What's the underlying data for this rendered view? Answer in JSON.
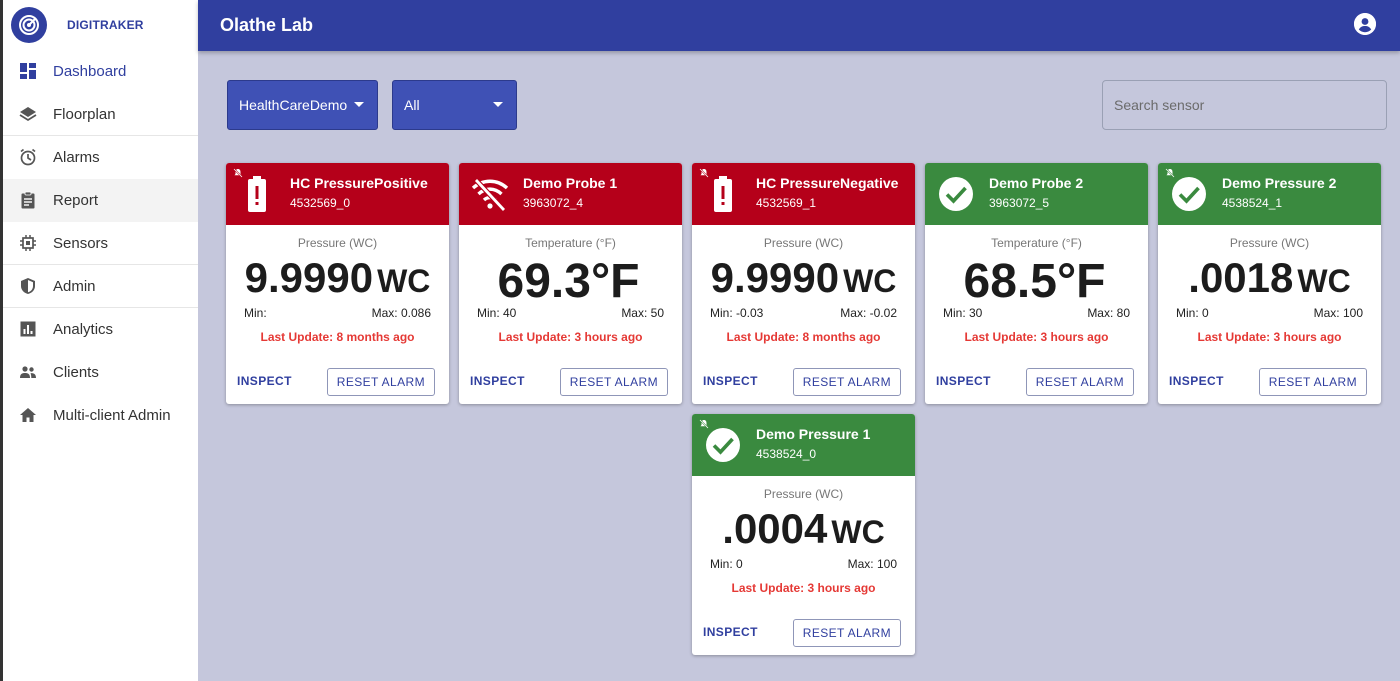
{
  "sidebar": {
    "brand": "DIGITRAKER",
    "items": [
      {
        "label": "Dashboard",
        "icon": "dashboard-icon"
      },
      {
        "label": "Floorplan",
        "icon": "layers-icon"
      },
      {
        "label": "Alarms",
        "icon": "alarm-clock-icon"
      },
      {
        "label": "Report",
        "icon": "clipboard-icon"
      },
      {
        "label": "Sensors",
        "icon": "chip-icon"
      },
      {
        "label": "Admin",
        "icon": "shield-icon"
      },
      {
        "label": "Analytics",
        "icon": "bar-chart-icon"
      },
      {
        "label": "Clients",
        "icon": "people-icon"
      },
      {
        "label": "Multi-client Admin",
        "icon": "home-icon"
      }
    ],
    "active": "Dashboard"
  },
  "header": {
    "title": "Olathe Lab"
  },
  "filters": {
    "group": "HealthCareDemo",
    "type": "All",
    "search_placeholder": "Search sensor"
  },
  "colors": {
    "primary": "#303f9f",
    "alarm": "#b5001a",
    "ok": "#3a8a3f",
    "update": "#e53935"
  },
  "cards": [
    {
      "name": "HC PressurePositive",
      "id": "4532569_0",
      "status": "alarm",
      "icon": "battery-alert-icon",
      "measure": "Pressure (WC)",
      "value": "9.9990",
      "unit": "WC",
      "min": "Min:",
      "max": "Max: 0.086",
      "update": "Last Update: 8 months ago",
      "inspect": "INSPECT",
      "reset": "RESET ALARM"
    },
    {
      "name": "Demo Probe 1",
      "id": "3963072_4",
      "status": "alarm",
      "icon": "wifi-off-icon",
      "measure": "Temperature (°F)",
      "value": "69.3°F",
      "unit": "",
      "min": "Min: 40",
      "max": "Max: 50",
      "update": "Last Update: 3 hours ago",
      "inspect": "INSPECT",
      "reset": "RESET ALARM"
    },
    {
      "name": "HC PressureNegative",
      "id": "4532569_1",
      "status": "alarm",
      "icon": "battery-alert-icon",
      "measure": "Pressure (WC)",
      "value": "9.9990",
      "unit": "WC",
      "min": "Min: -0.03",
      "max": "Max: -0.02",
      "update": "Last Update: 8 months ago",
      "inspect": "INSPECT",
      "reset": "RESET ALARM"
    },
    {
      "name": "Demo Probe 2",
      "id": "3963072_5",
      "status": "ok",
      "icon": "check-circle-icon",
      "measure": "Temperature (°F)",
      "value": "68.5°F",
      "unit": "",
      "min": "Min: 30",
      "max": "Max: 80",
      "update": "Last Update: 3 hours ago",
      "inspect": "INSPECT",
      "reset": "RESET ALARM"
    },
    {
      "name": "Demo Pressure 2",
      "id": "4538524_1",
      "status": "ok",
      "icon": "check-circle-icon",
      "measure": "Pressure (WC)",
      "value": ".0018",
      "unit": "WC",
      "min": "Min: 0",
      "max": "Max: 100",
      "update": "Last Update: 3 hours ago",
      "inspect": "INSPECT",
      "reset": "RESET ALARM"
    },
    {
      "name": "Demo Pressure 1",
      "id": "4538524_0",
      "status": "ok",
      "icon": "check-circle-icon",
      "measure": "Pressure (WC)",
      "value": ".0004",
      "unit": "WC",
      "min": "Min: 0",
      "max": "Max: 100",
      "update": "Last Update: 3 hours ago",
      "inspect": "INSPECT",
      "reset": "RESET ALARM"
    }
  ]
}
